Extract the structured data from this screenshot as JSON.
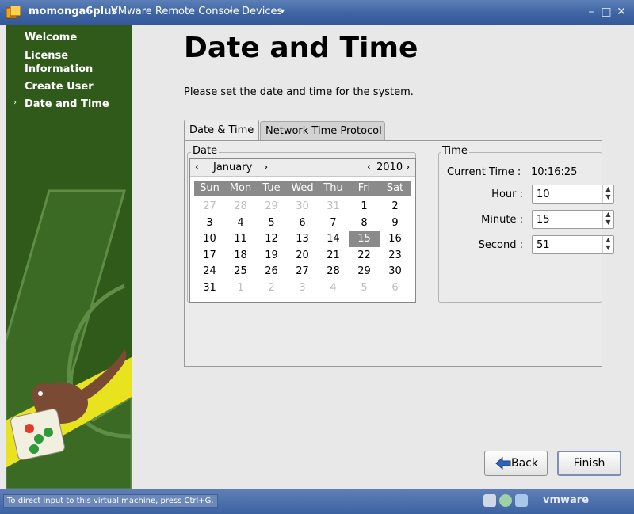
{
  "titlebar": {
    "app_name": "momonga6plus",
    "console_menu": "VMware Remote Console",
    "devices_menu": "Devices",
    "arrow_glyph": "▾",
    "minimize_glyph": "–",
    "maximize_glyph": "□",
    "close_glyph": "✕"
  },
  "sidebar": {
    "bullet": "›",
    "items": [
      {
        "label": "Welcome"
      },
      {
        "label": "License Information"
      },
      {
        "label": "Create User"
      },
      {
        "label": "Date and Time",
        "current": true
      }
    ]
  },
  "main": {
    "title": "Date and Time",
    "intro": "Please set the date and time for the system.",
    "tabs": [
      {
        "label": "Date & Time",
        "active": true
      },
      {
        "label": "Network Time Protocol",
        "active": false
      }
    ]
  },
  "date": {
    "legend": "Date",
    "month": "January",
    "year": "2010",
    "prev_glyph": "‹",
    "next_glyph": "›",
    "weekdays": [
      "Sun",
      "Mon",
      "Tue",
      "Wed",
      "Thu",
      "Fri",
      "Sat"
    ],
    "weeks": [
      [
        "27",
        "28",
        "29",
        "30",
        "31",
        "1",
        "2"
      ],
      [
        "3",
        "4",
        "5",
        "6",
        "7",
        "8",
        "9"
      ],
      [
        "10",
        "11",
        "12",
        "13",
        "14",
        "15",
        "16"
      ],
      [
        "17",
        "18",
        "19",
        "20",
        "21",
        "22",
        "23"
      ],
      [
        "24",
        "25",
        "26",
        "27",
        "28",
        "29",
        "30"
      ],
      [
        "31",
        "1",
        "2",
        "3",
        "4",
        "5",
        "6"
      ]
    ],
    "selected_day": "15"
  },
  "time": {
    "legend": "Time",
    "current_time_label": "Current Time :",
    "current_time_value": "10:16:25",
    "hour_label": "Hour :",
    "hour_value": "10",
    "minute_label": "Minute :",
    "minute_value": "15",
    "second_label": "Second :",
    "second_value": "51"
  },
  "buttons": {
    "back": "Back",
    "finish": "Finish"
  },
  "statusbar": {
    "hint": "To direct input to this virtual machine, press Ctrl+G.",
    "vendor": "vmware"
  },
  "colors": {
    "sidebar_green": "#2f5a1a",
    "selection_gray": "#8a8a8a",
    "titlebar_blue": "#3e64a3"
  }
}
